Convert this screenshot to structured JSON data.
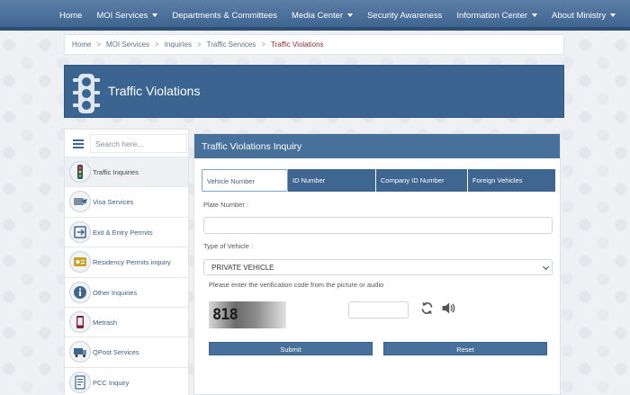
{
  "nav": {
    "items": [
      {
        "label": "Home",
        "has_dropdown": false
      },
      {
        "label": "MOI Services",
        "has_dropdown": true
      },
      {
        "label": "Departments & Committees",
        "has_dropdown": false
      },
      {
        "label": "Media Center",
        "has_dropdown": true
      },
      {
        "label": "Security Awareness",
        "has_dropdown": false
      },
      {
        "label": "Information Center",
        "has_dropdown": true
      },
      {
        "label": "About Ministry",
        "has_dropdown": true
      }
    ]
  },
  "breadcrumb": {
    "items": [
      "Home",
      "MOI Services",
      "Inquiries",
      "Traffic Services",
      "Traffic Violations"
    ],
    "separator": ">"
  },
  "banner": {
    "title": "Traffic Violations",
    "icon": "traffic-light-icon"
  },
  "sidebar": {
    "search_placeholder": "Search here...",
    "items": [
      {
        "label": "Traffic Inquiries",
        "icon": "traffic-light-icon",
        "active": true
      },
      {
        "label": "Visa Services",
        "icon": "visa-icon",
        "active": false
      },
      {
        "label": "Exit & Entry Permits",
        "icon": "exit-entry-icon",
        "active": false
      },
      {
        "label": "Residency Permits inquiry",
        "icon": "residency-icon",
        "active": false
      },
      {
        "label": "Other Inquiries",
        "icon": "info-icon",
        "active": false
      },
      {
        "label": "Metrash",
        "icon": "metrash-icon",
        "active": false
      },
      {
        "label": "QPost Services",
        "icon": "qpost-icon",
        "active": false
      },
      {
        "label": "PCC Inquiry",
        "icon": "pcc-icon",
        "active": false
      }
    ]
  },
  "inquiry": {
    "title": "Traffic Violations Inquiry",
    "tabs": [
      {
        "label": "Vehicle Number",
        "active": true
      },
      {
        "label": "ID Number",
        "active": false
      },
      {
        "label": "Company ID Number",
        "active": false
      },
      {
        "label": "Foreign Vehicles",
        "active": false
      }
    ],
    "plate_label": "Plate Number :",
    "plate_value": "",
    "vehicle_type_label": "Type of Vehicle :",
    "vehicle_type_selected": "PRIVATE VEHICLE",
    "captcha_instruction": "Please enter the verification code from the picture or audio",
    "captcha_code": "818",
    "captcha_value": "",
    "submit_label": "Submit",
    "reset_label": "Reset"
  },
  "colors": {
    "primary": "#3f6591",
    "header": "#47709a",
    "breadcrumb_current": "#9a2a3a"
  }
}
